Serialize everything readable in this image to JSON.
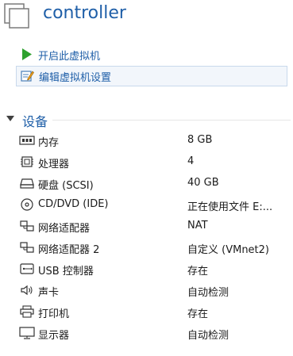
{
  "header": {
    "title": "controller",
    "icon": "vm-icon"
  },
  "actions": [
    {
      "label": "开启此虚拟机",
      "icon": "power-on-icon",
      "color": "#2ea12e"
    },
    {
      "label": "编辑虚拟机设置",
      "icon": "edit-settings-icon"
    }
  ],
  "devices_section": {
    "label": "设备",
    "expanded": true
  },
  "devices": [
    {
      "name": "内存",
      "value": "8 GB",
      "icon": "memory-icon"
    },
    {
      "name": "处理器",
      "value": "4",
      "icon": "cpu-icon"
    },
    {
      "name": "硬盘 (SCSI)",
      "value": "40 GB",
      "icon": "hard-disk-icon"
    },
    {
      "name": "CD/DVD (IDE)",
      "value": "正在使用文件 E:...",
      "icon": "cd-dvd-icon"
    },
    {
      "name": "网络适配器",
      "value": "NAT",
      "icon": "network-adapter-icon"
    },
    {
      "name": "网络适配器 2",
      "value": "自定义 (VMnet2)",
      "icon": "network-adapter-icon"
    },
    {
      "name": "USB 控制器",
      "value": "存在",
      "icon": "usb-icon"
    },
    {
      "name": "声卡",
      "value": "自动检测",
      "icon": "sound-icon"
    },
    {
      "name": "打印机",
      "value": "存在",
      "icon": "printer-icon"
    },
    {
      "name": "显示器",
      "value": "自动检测",
      "icon": "display-icon"
    }
  ],
  "colors": {
    "accent": "#1f5fa8",
    "play": "#2ea12e",
    "selected_bg": "#f2f6fb"
  }
}
